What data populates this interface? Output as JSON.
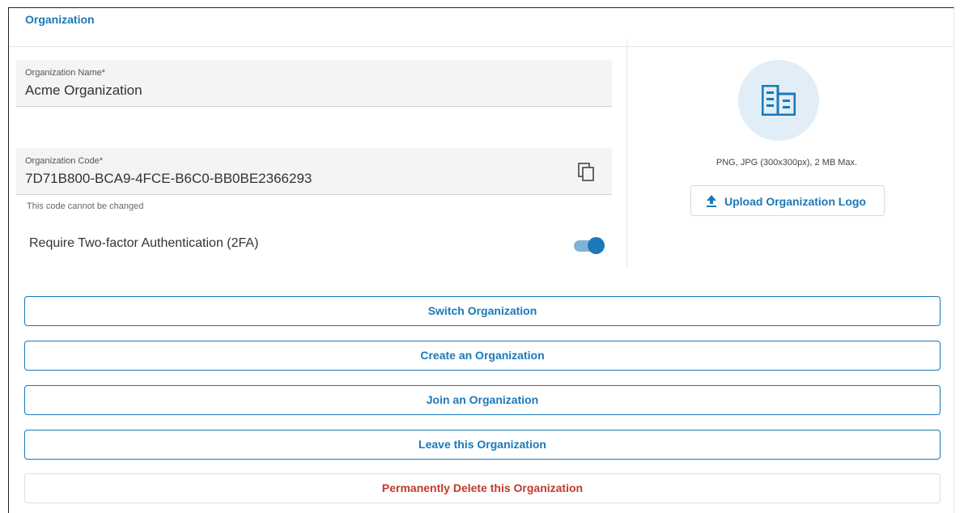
{
  "header": {
    "title": "Organization"
  },
  "form": {
    "org_name": {
      "label": "Organization Name",
      "required_marker": "*",
      "value": "Acme Organization"
    },
    "org_code": {
      "label": "Organization Code",
      "required_marker": "*",
      "value": "7D71B800-BCA9-4FCE-B6C0-BB0BE2366293",
      "helper": "This code cannot be changed"
    },
    "two_factor": {
      "label": "Require Two-factor Authentication (2FA)",
      "enabled": true
    }
  },
  "logo_panel": {
    "icon": "building-icon",
    "hint": "PNG, JPG (300x300px), 2 MB Max.",
    "upload_label": "Upload Organization Logo",
    "upload_icon": "upload-icon"
  },
  "actions": [
    {
      "label": "Switch Organization"
    },
    {
      "label": "Create an Organization"
    },
    {
      "label": "Join an Organization"
    },
    {
      "label": "Leave this Organization"
    },
    {
      "label": "Permanently Delete this Organization",
      "danger": true
    }
  ],
  "colors": {
    "accent": "#1a79b8",
    "danger": "#c0392b",
    "field_bg": "#f4f4f4",
    "logo_circle_bg": "#e2eef7"
  }
}
